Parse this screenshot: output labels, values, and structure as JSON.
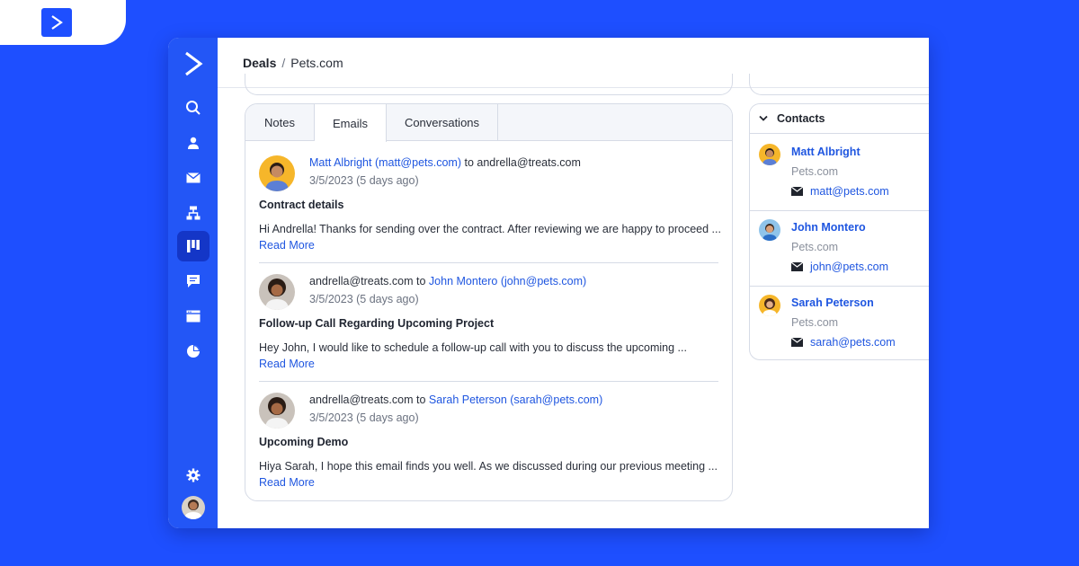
{
  "colors": {
    "brand": "#1e4fff",
    "sidebar": "#2356f6",
    "link": "#1f56e0"
  },
  "breadcrumb": {
    "root": "Deals",
    "separator": "/",
    "current": "Pets.com"
  },
  "tabs": [
    {
      "label": "Notes",
      "active": false
    },
    {
      "label": "Emails",
      "active": true
    },
    {
      "label": "Conversations",
      "active": false
    }
  ],
  "emails": [
    {
      "from": "Matt Albright (matt@pets.com)",
      "to_word": "to",
      "to": "andrella@treats.com",
      "from_is_link": true,
      "date": "3/5/2023 (5 days ago)",
      "subject": "Contract details",
      "body": "Hi Andrella! Thanks for sending over the contract. After reviewing we are happy to proceed ...",
      "read_more": "Read More"
    },
    {
      "from": "andrella@treats.com",
      "to_word": "to",
      "to": "John Montero (john@pets.com)",
      "from_is_link": false,
      "date": "3/5/2023 (5 days ago)",
      "subject": "Follow-up Call Regarding Upcoming Project",
      "body": "Hey John, I would like to schedule a follow-up call with you to discuss the upcoming ...",
      "read_more": "Read More"
    },
    {
      "from": "andrella@treats.com",
      "to_word": "to",
      "to": "Sarah Peterson (sarah@pets.com)",
      "from_is_link": false,
      "date": "3/5/2023 (5 days ago)",
      "subject": "Upcoming Demo",
      "body": "Hiya Sarah, I hope this email finds you well. As we discussed during our previous meeting ...",
      "read_more": "Read More"
    }
  ],
  "contacts": {
    "title": "Contacts",
    "items": [
      {
        "name": "Matt Albright",
        "company": "Pets.com",
        "email": "matt@pets.com"
      },
      {
        "name": "John Montero",
        "company": "Pets.com",
        "email": "john@pets.com"
      },
      {
        "name": "Sarah Peterson",
        "company": "Pets.com",
        "email": "sarah@pets.com"
      }
    ]
  },
  "icons": {
    "sidebar": [
      "search-icon",
      "contacts-icon",
      "mail-icon",
      "automations-icon",
      "deals-board-icon",
      "conversations-icon",
      "site-icon",
      "reports-icon",
      "settings-icon",
      "user-avatar"
    ]
  }
}
